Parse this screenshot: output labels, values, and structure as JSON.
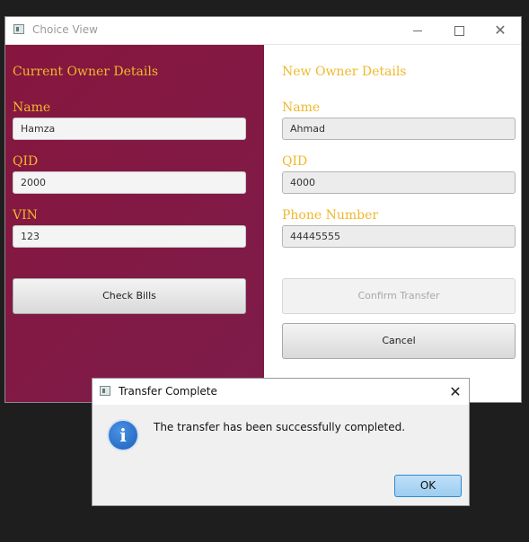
{
  "main_window": {
    "title": "Choice View",
    "close_glyph": "✕",
    "icons": {
      "app": "app-window-icon",
      "minimize": "minimize-icon",
      "maximize": "maximize-icon",
      "close": "close-icon"
    }
  },
  "current_owner": {
    "heading": "Current Owner Details",
    "name_label": "Name",
    "name_value": "Hamza",
    "qid_label": "QID",
    "qid_value": "2000",
    "vin_label": "VIN",
    "vin_value": "123",
    "check_bills_label": "Check Bills"
  },
  "new_owner": {
    "heading": "New Owner Details",
    "name_label": "Name",
    "name_value": "Ahmad",
    "qid_label": "QID",
    "qid_value": "4000",
    "phone_label": "Phone Number",
    "phone_value": "44445555",
    "confirm_label": "Confirm Transfer",
    "cancel_label": "Cancel"
  },
  "dialog": {
    "title": "Transfer Complete",
    "message": "The transfer has been successfully completed.",
    "ok_label": "OK",
    "close_glyph": "✕",
    "info_glyph": "i",
    "icons": {
      "info": "info-icon",
      "close": "close-icon"
    }
  },
  "colors": {
    "left_panel": "#86163e",
    "accent_text": "#f0b82a",
    "background": "#1e1e1e"
  }
}
